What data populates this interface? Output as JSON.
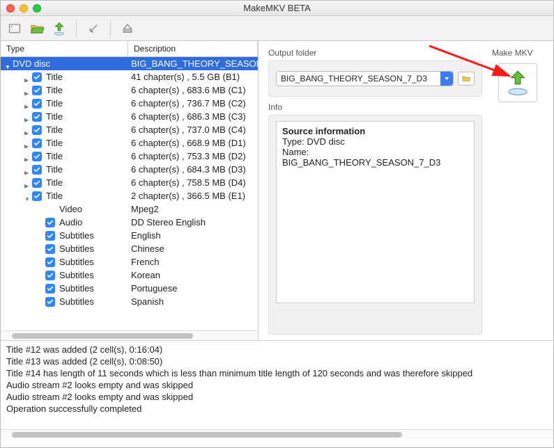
{
  "window_title": "MakeMKV BETA",
  "columns": {
    "type": "Type",
    "description": "Description"
  },
  "tree_root": {
    "type": "DVD disc",
    "desc": "BIG_BANG_THEORY_SEASON_"
  },
  "titles": [
    {
      "type": "Title",
      "desc": "41 chapter(s) , 5.5 GB (B1)",
      "expanded": false
    },
    {
      "type": "Title",
      "desc": "6 chapter(s) , 683.6 MB (C1)",
      "expanded": false
    },
    {
      "type": "Title",
      "desc": "6 chapter(s) , 736.7 MB (C2)",
      "expanded": false
    },
    {
      "type": "Title",
      "desc": "6 chapter(s) , 686.3 MB (C3)",
      "expanded": false
    },
    {
      "type": "Title",
      "desc": "6 chapter(s) , 737.0 MB (C4)",
      "expanded": false
    },
    {
      "type": "Title",
      "desc": "6 chapter(s) , 668.9 MB (D1)",
      "expanded": false
    },
    {
      "type": "Title",
      "desc": "6 chapter(s) , 753.3 MB (D2)",
      "expanded": false
    },
    {
      "type": "Title",
      "desc": "6 chapter(s) , 684.3 MB (D3)",
      "expanded": false
    },
    {
      "type": "Title",
      "desc": "6 chapter(s) , 758.5 MB (D4)",
      "expanded": false
    },
    {
      "type": "Title",
      "desc": "2 chapter(s) , 366.5 MB (E1)",
      "expanded": true
    }
  ],
  "expanded_children": [
    {
      "check": false,
      "type": "Video",
      "desc": "Mpeg2"
    },
    {
      "check": true,
      "type": "Audio",
      "desc": "DD Stereo English"
    },
    {
      "check": true,
      "type": "Subtitles",
      "desc": "English"
    },
    {
      "check": true,
      "type": "Subtitles",
      "desc": "Chinese"
    },
    {
      "check": true,
      "type": "Subtitles",
      "desc": "French"
    },
    {
      "check": true,
      "type": "Subtitles",
      "desc": "Korean"
    },
    {
      "check": true,
      "type": "Subtitles",
      "desc": "Portuguese"
    },
    {
      "check": true,
      "type": "Subtitles",
      "desc": "Spanish"
    }
  ],
  "output": {
    "label": "Output folder",
    "value": "BIG_BANG_THEORY_SEASON_7_D3"
  },
  "makemkv": {
    "label": "Make MKV"
  },
  "info": {
    "label": "Info",
    "heading": "Source information",
    "line1": "Type: DVD disc",
    "line2": "Name: BIG_BANG_THEORY_SEASON_7_D3"
  },
  "log": [
    "Title #12 was added (2 cell(s), 0:16:04)",
    "Title #13 was added (2 cell(s), 0:08:50)",
    "Title #14 has length of 11 seconds which is less than minimum title length of 120 seconds and was therefore skipped",
    "Audio stream #2 looks empty and was skipped",
    "Audio stream #2 looks empty and was skipped",
    "Operation successfully completed"
  ]
}
